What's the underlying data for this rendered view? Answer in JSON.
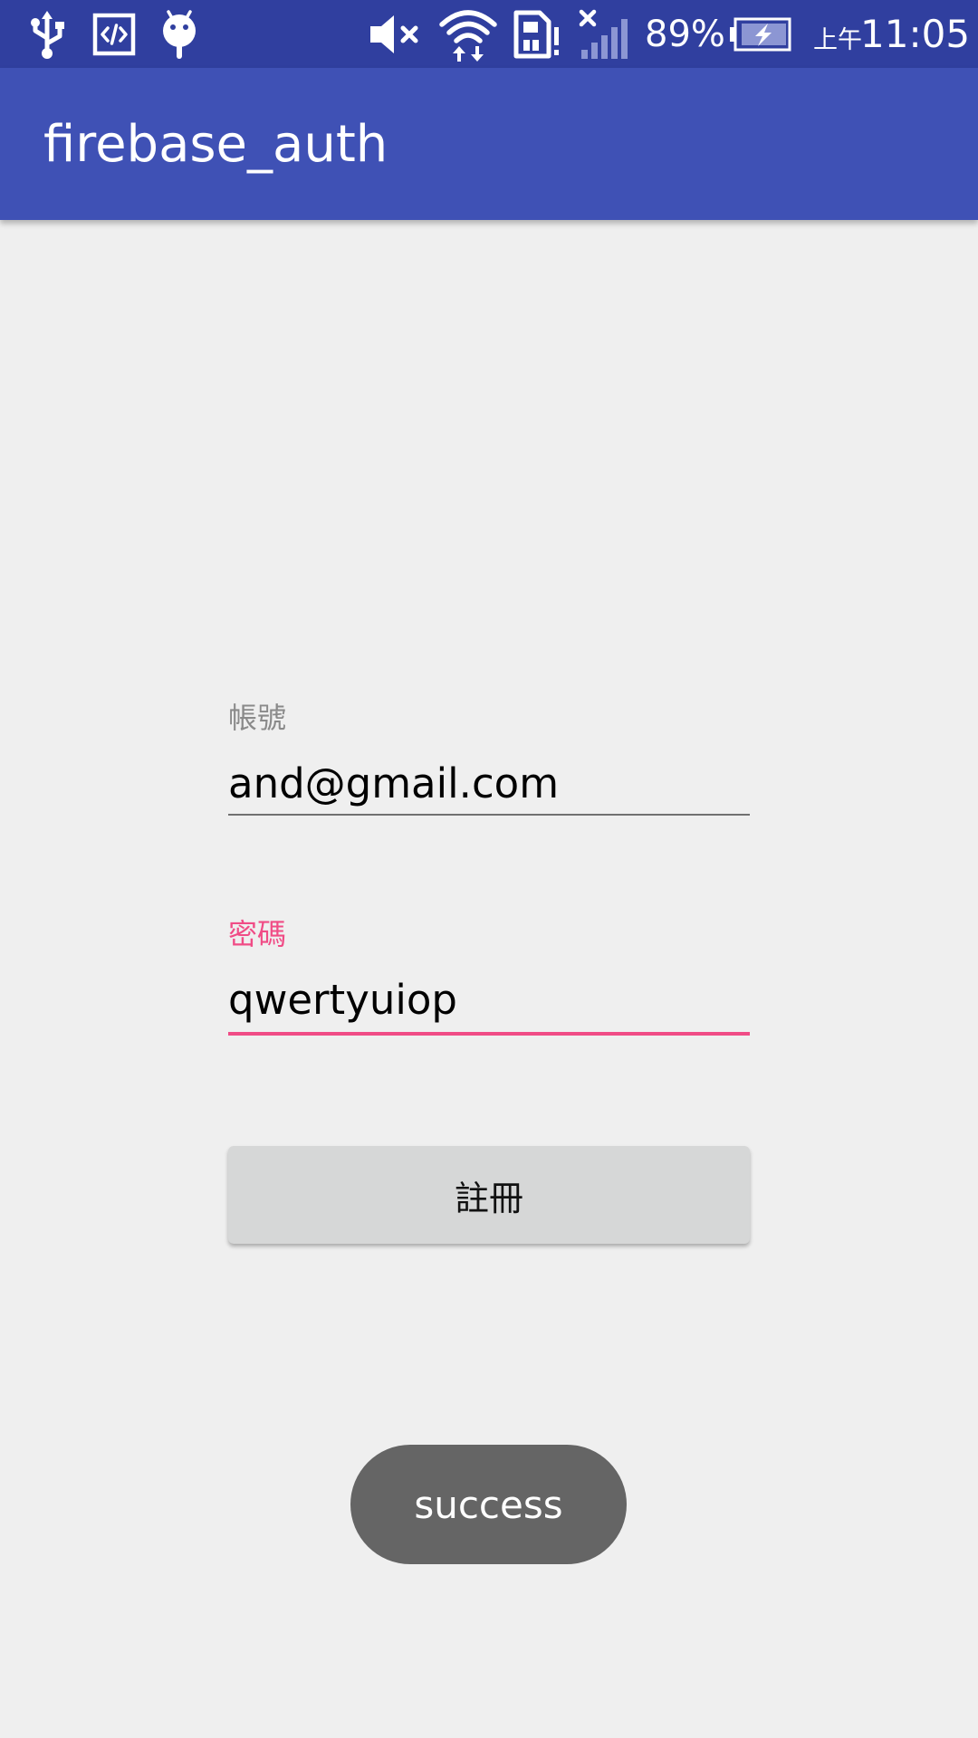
{
  "status_bar": {
    "battery_percent": "89%",
    "time_prefix": "上午",
    "time": "11:05",
    "left_icons": [
      "usb-icon",
      "developer-code-icon",
      "android-icon"
    ],
    "right_icons": [
      "mute-icon",
      "wifi-icon",
      "sim-alert-icon",
      "no-signal-icon",
      "battery-charging-icon"
    ]
  },
  "app_bar": {
    "title": "firebase_auth"
  },
  "form": {
    "account": {
      "label": "帳號",
      "value": "and@gmail.com"
    },
    "password": {
      "label": "密碼",
      "value": "qwertyuiop"
    },
    "register_label": "註冊"
  },
  "toast": {
    "message": "success"
  },
  "colors": {
    "status_bar": "#303f9f",
    "primary": "#3f51b5",
    "accent": "#f04c86",
    "background": "#efefef",
    "button": "#d6d7d7",
    "toast": "#656565",
    "label_inactive": "#8a8a8a",
    "underline_inactive": "#707070"
  }
}
